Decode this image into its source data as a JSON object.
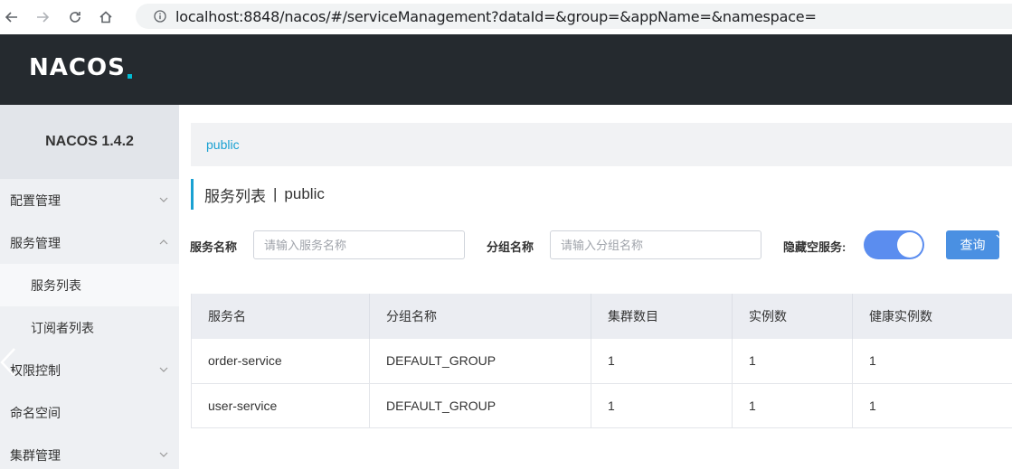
{
  "browser": {
    "url": "localhost:8848/nacos/#/serviceManagement?dataId=&group=&appName=&namespace="
  },
  "header": {
    "logo": "NACOS"
  },
  "sidebar": {
    "version": "NACOS 1.4.2",
    "items": [
      {
        "label": "配置管理"
      },
      {
        "label": "服务管理"
      },
      {
        "label": "服务列表"
      },
      {
        "label": "订阅者列表"
      },
      {
        "label": "权限控制"
      },
      {
        "label": "命名空间"
      },
      {
        "label": "集群管理"
      }
    ]
  },
  "breadcrumb": {
    "namespace": "public"
  },
  "page": {
    "title": "服务列表",
    "separator": "|",
    "namespace": "public"
  },
  "filters": {
    "service_name_label": "服务名称",
    "service_name_placeholder": "请输入服务名称",
    "group_name_label": "分组名称",
    "group_name_placeholder": "请输入分组名称",
    "hide_empty_label": "隐藏空服务:",
    "query_label": "查询"
  },
  "table": {
    "headers": [
      "服务名",
      "分组名称",
      "集群数目",
      "实例数",
      "健康实例数"
    ],
    "rows": [
      [
        "order-service",
        "DEFAULT_GROUP",
        "1",
        "1",
        "1"
      ],
      [
        "user-service",
        "DEFAULT_GROUP",
        "1",
        "1",
        "1"
      ]
    ]
  },
  "colors": {
    "header_bg": "#252a2f",
    "accent": "#1aa1d2",
    "toggle": "#5b8def",
    "button": "#4a90e2"
  }
}
